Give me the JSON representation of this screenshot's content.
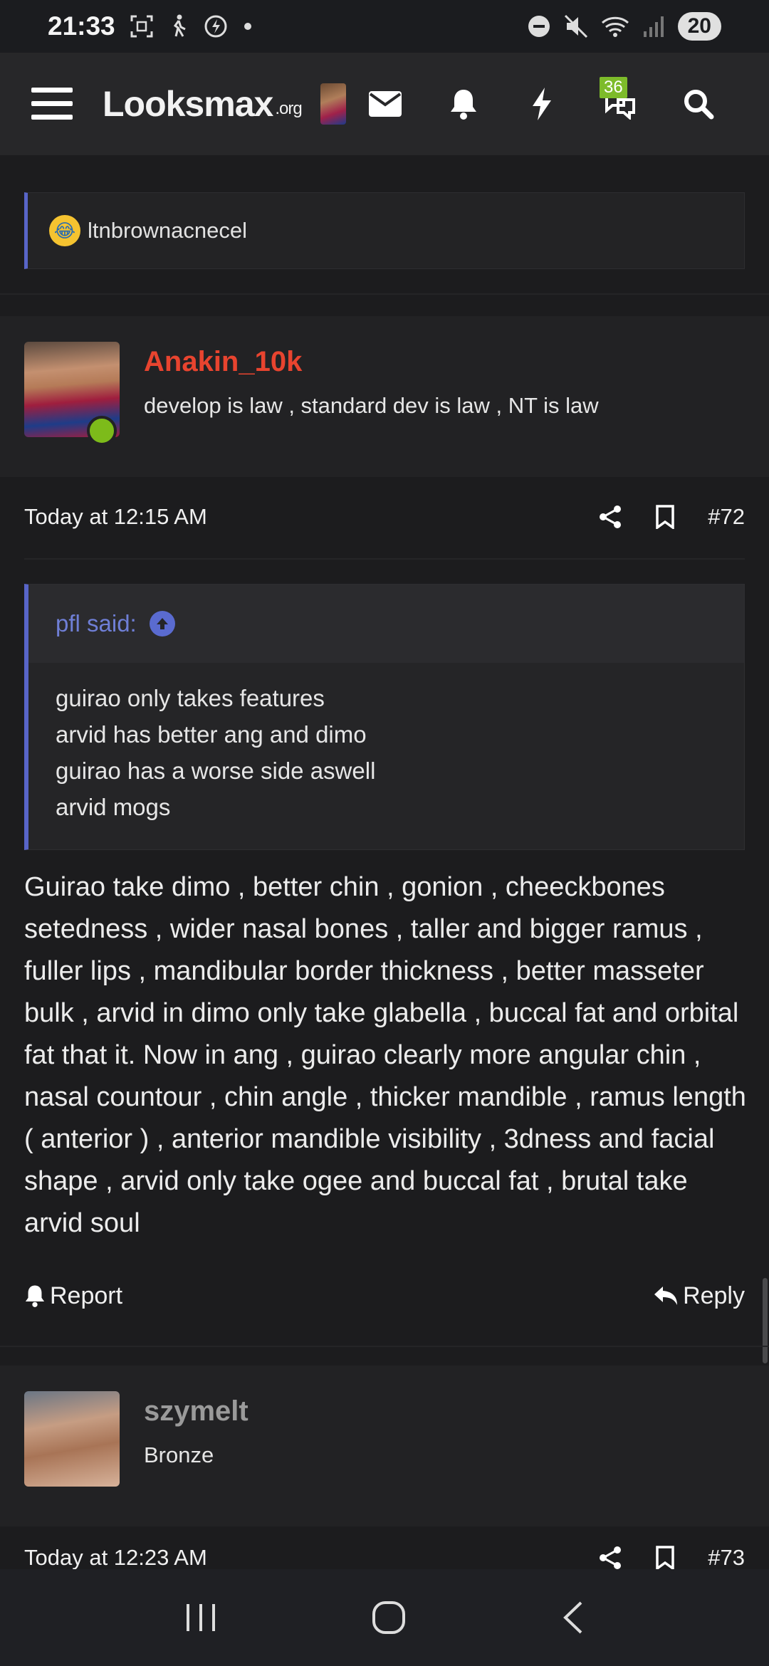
{
  "status_bar": {
    "time": "21:33",
    "left_icons": [
      "screenshot-icon",
      "walking-icon",
      "data-saver-icon",
      "dot-icon"
    ],
    "right_icons": [
      "dnd-icon",
      "mute-icon",
      "wifi-icon",
      "signal-icon"
    ],
    "battery": "20"
  },
  "navbar": {
    "logo_main": "Looksmax",
    "logo_suffix": ".org",
    "messages_badge": "36"
  },
  "previous_quote": {
    "text": "ltnbrownacnecel"
  },
  "post_72": {
    "username": "Anakin_10k",
    "username_color": "#e8442f",
    "user_title": "develop is law , standard dev is law , NT is law",
    "time": "Today at 12:15 AM",
    "number": "#72",
    "quote_author": "pfl said:",
    "quote_lines": [
      "guirao only takes features",
      "arvid has better ang and dimo",
      "guirao has a worse side aswell",
      "arvid mogs"
    ],
    "body": "Guirao take dimo , better chin , gonion , cheeckbones setedness , wider nasal bones , taller and bigger ramus , fuller lips , mandibular border thickness , better masseter bulk , arvid in dimo only take glabella , buccal fat and orbital fat that it. Now in ang , guirao clearly more angular chin , nasal countour , chin angle , thicker mandible , ramus length ( anterior ) , anterior mandible visibility , 3dness and facial shape , arvid only take ogee and buccal fat , brutal take arvid soul",
    "report_label": "Report",
    "reply_label": "Reply"
  },
  "post_73": {
    "username": "szymelt",
    "username_color": "#9a9a9a",
    "user_title": "Bronze",
    "time": "Today at 12:23 AM",
    "number": "#73"
  },
  "colors": {
    "background": "#1c1c1e",
    "navbar": "#272729",
    "quote_accent": "#5865c8",
    "online": "#7dbb1a"
  }
}
